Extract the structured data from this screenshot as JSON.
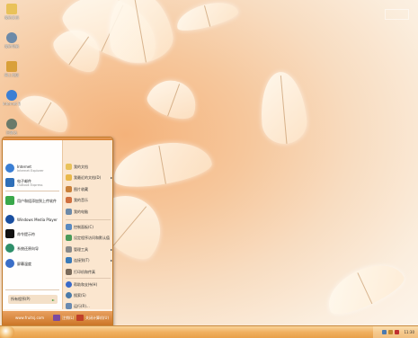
{
  "desktop": {
    "watermark": "",
    "icons": [
      {
        "label": "我的文档",
        "color": "#e9c25a"
      },
      {
        "label": "我的电脑",
        "color": "#6d8aa8"
      },
      {
        "label": "网上邻居",
        "color": "#d9a03a"
      },
      {
        "label": "Internet Explorer",
        "color": "#3b7fd4"
      },
      {
        "label": "回收站",
        "color": "#6a7a6a"
      }
    ]
  },
  "start_menu": {
    "left_items": [
      {
        "title": "Internet",
        "sub": "Internet Explorer",
        "color": "#3b7fd4"
      },
      {
        "title": "电子邮件",
        "sub": "Outlook Express",
        "color": "#2f6fb8"
      },
      {
        "title": "用户和组添加到上传软件",
        "sub": "",
        "color": "#3aa84a"
      },
      {
        "title": "Windows Media Player",
        "sub": "",
        "color": "#1a4fa0"
      },
      {
        "title": "命令提示符",
        "sub": "",
        "color": "#111111"
      },
      {
        "title": "系统还原向导",
        "sub": "",
        "color": "#2f8f6a"
      },
      {
        "title": "屏幕温度",
        "sub": "",
        "color": "#3b6fc8"
      }
    ],
    "all_programs": "所有程序(P)",
    "right_items": [
      {
        "label": "我的文档",
        "arrow": "",
        "color": "#e9c25a"
      },
      {
        "label": "我最近的文档(D)",
        "arrow": "▸",
        "color": "#e9b84a"
      },
      {
        "label": "图片收藏",
        "arrow": "",
        "color": "#c9803a"
      },
      {
        "label": "我的音乐",
        "arrow": "",
        "color": "#d07040"
      },
      {
        "label": "我的电脑",
        "arrow": "",
        "color": "#6d8aa8"
      },
      {
        "label": "控制面板(C)",
        "arrow": "",
        "color": "#5a8ac0"
      },
      {
        "label": "设定程序访问和默认值",
        "arrow": "",
        "color": "#4a9a5a"
      },
      {
        "label": "管理工具",
        "arrow": "▸",
        "color": "#8a8a8a"
      },
      {
        "label": "连接到(T)",
        "arrow": "▸",
        "color": "#3a7ab8"
      },
      {
        "label": "打印机和传真",
        "arrow": "",
        "color": "#7a6a5a"
      },
      {
        "label": "帮助和支持(H)",
        "arrow": "",
        "color": "#3a6ac8"
      },
      {
        "label": "搜索(S)",
        "arrow": "",
        "color": "#4a7aa8"
      },
      {
        "label": "运行(R)...",
        "arrow": "",
        "color": "#6a8ab0"
      }
    ],
    "url": "www.fruitsj.com",
    "logoff": "注销(L)",
    "shutdown": "关闭计算机(U)"
  },
  "taskbar": {
    "clock": "11:30"
  }
}
